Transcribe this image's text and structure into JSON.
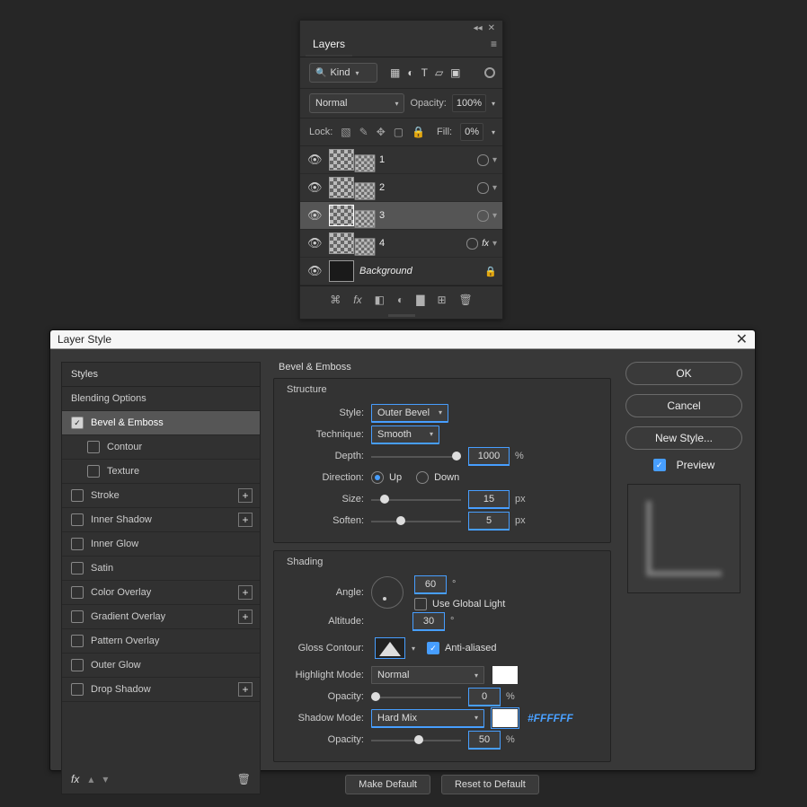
{
  "layers_panel": {
    "tab": "Layers",
    "filter": {
      "kind_label": "Kind"
    },
    "blend": {
      "mode": "Normal",
      "opacity_label": "Opacity:",
      "opacity_value": "100%"
    },
    "lock": {
      "label": "Lock:",
      "fill_label": "Fill:",
      "fill_value": "0%"
    },
    "items": [
      {
        "name": "1",
        "fx": false,
        "locked": false,
        "italic": false
      },
      {
        "name": "2",
        "fx": false,
        "locked": false,
        "italic": false
      },
      {
        "name": "3",
        "fx": false,
        "locked": false,
        "italic": false,
        "selected": true
      },
      {
        "name": "4",
        "fx": true,
        "locked": false,
        "italic": false
      },
      {
        "name": "Background",
        "fx": false,
        "locked": true,
        "italic": true,
        "bg": true
      }
    ]
  },
  "dialog": {
    "title": "Layer Style",
    "styles_header": "Styles",
    "list": {
      "blending_options": "Blending Options",
      "bevel_emboss": "Bevel & Emboss",
      "contour": "Contour",
      "texture": "Texture",
      "stroke": "Stroke",
      "inner_shadow": "Inner Shadow",
      "inner_glow": "Inner Glow",
      "satin": "Satin",
      "color_overlay": "Color Overlay",
      "gradient_overlay": "Gradient Overlay",
      "pattern_overlay": "Pattern Overlay",
      "outer_glow": "Outer Glow",
      "drop_shadow": "Drop Shadow"
    },
    "section_title": "Bevel & Emboss",
    "structure": {
      "legend": "Structure",
      "style_label": "Style:",
      "style_value": "Outer Bevel",
      "technique_label": "Technique:",
      "technique_value": "Smooth",
      "depth_label": "Depth:",
      "depth_value": "1000",
      "depth_unit": "%",
      "direction_label": "Direction:",
      "up": "Up",
      "down": "Down",
      "size_label": "Size:",
      "size_value": "15",
      "size_unit": "px",
      "soften_label": "Soften:",
      "soften_value": "5",
      "soften_unit": "px"
    },
    "shading": {
      "legend": "Shading",
      "angle_label": "Angle:",
      "angle_value": "60",
      "angle_unit": "°",
      "global_light": "Use Global Light",
      "altitude_label": "Altitude:",
      "altitude_value": "30",
      "altitude_unit": "°",
      "gloss_label": "Gloss Contour:",
      "anti_aliased": "Anti-aliased",
      "highlight_mode_label": "Highlight Mode:",
      "highlight_mode_value": "Normal",
      "highlight_opacity_label": "Opacity:",
      "highlight_opacity_value": "0",
      "highlight_opacity_unit": "%",
      "shadow_mode_label": "Shadow Mode:",
      "shadow_mode_value": "Hard Mix",
      "shadow_color_hex": "#FFFFFF",
      "shadow_opacity_label": "Opacity:",
      "shadow_opacity_value": "50",
      "shadow_opacity_unit": "%"
    },
    "make_default": "Make Default",
    "reset_default": "Reset to Default",
    "buttons": {
      "ok": "OK",
      "cancel": "Cancel",
      "new_style": "New Style..."
    },
    "preview_label": "Preview"
  }
}
